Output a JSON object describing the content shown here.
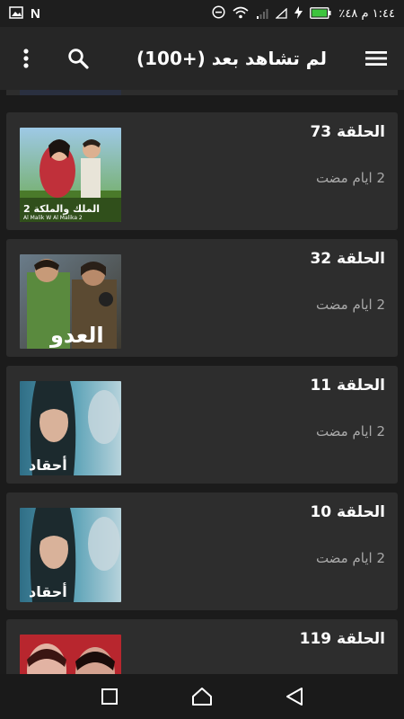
{
  "status_bar": {
    "time_text": "١:٤٤ م ٤٨٪",
    "n_badge": "N"
  },
  "header": {
    "title": "لم تشاهد بعد (+100)"
  },
  "episodes": [
    {
      "episode": "الحلقة 73",
      "ago": "2 ايام مضت",
      "poster_caption": "الملك والملكة 2",
      "poster_sub": "Al Malik W Al Malika 2"
    },
    {
      "episode": "الحلقة 32",
      "ago": "2 ايام مضت",
      "poster_caption": "العدو",
      "poster_sub": ""
    },
    {
      "episode": "الحلقة 11",
      "ago": "2 ايام مضت",
      "poster_caption": "أحقاد",
      "poster_sub": ""
    },
    {
      "episode": "الحلقة 10",
      "ago": "2 ايام مضت",
      "poster_caption": "أحقاد",
      "poster_sub": ""
    },
    {
      "episode": "الحلقة 119",
      "ago": "",
      "poster_caption": "",
      "poster_sub": ""
    }
  ],
  "colors": {
    "background": "#1b1b1b",
    "card": "#2d2d2d",
    "appbar": "#262626",
    "subtext": "#a9a9a9",
    "battery": "#3ec43e"
  }
}
